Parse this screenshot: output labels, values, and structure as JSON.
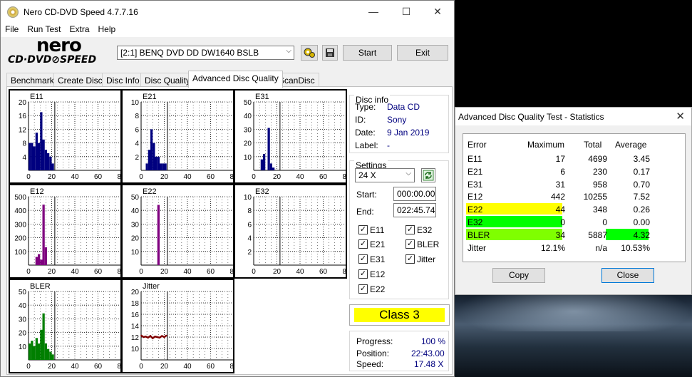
{
  "window": {
    "title": "Nero CD-DVD Speed 4.7.7.16",
    "menu": [
      "File",
      "Run Test",
      "Extra",
      "Help"
    ],
    "controls": [
      "—",
      "☐",
      "✕"
    ]
  },
  "logo": {
    "top": "nero",
    "bottom": "CD·DVD⊘SPEED"
  },
  "toolbar": {
    "drive": "[2:1]   BENQ DVD DD DW1640 BSLB",
    "start_label": "Start",
    "exit_label": "Exit"
  },
  "tabs": [
    "Benchmark",
    "Create Disc",
    "Disc Info",
    "Disc Quality",
    "Advanced Disc Quality",
    "ScanDisc"
  ],
  "active_tab": "Advanced Disc Quality",
  "disc_info": {
    "caption": "Disc info",
    "type_label": "Type:",
    "type": "Data CD",
    "id_label": "ID:",
    "id": "Sony",
    "date_label": "Date:",
    "date": "9 Jan 2019",
    "label_label": "Label:",
    "label": "-"
  },
  "settings": {
    "caption": "Settings",
    "speed": "24 X",
    "start_label": "Start:",
    "start": "000:00.00",
    "end_label": "End:",
    "end": "022:45.74",
    "checks": [
      {
        "label": "E11",
        "checked": true
      },
      {
        "label": "E32",
        "checked": true
      },
      {
        "label": "E21",
        "checked": true
      },
      {
        "label": "BLER",
        "checked": true
      },
      {
        "label": "E31",
        "checked": true
      },
      {
        "label": "Jitter",
        "checked": true
      },
      {
        "label": "E12",
        "checked": true
      },
      {
        "label": "E22",
        "checked": true
      }
    ]
  },
  "class_label": "Class 3",
  "progress": {
    "progress_label": "Progress:",
    "progress": "100 %",
    "position_label": "Position:",
    "position": "22:43.00",
    "speed_label": "Speed:",
    "speed": "17.48 X"
  },
  "colors": {
    "yellow": "#ffff00",
    "green": "#00ff00",
    "bler_green": "#7fff00",
    "plot_blue": "#00007f",
    "plot_purple": "#7f007f",
    "plot_green": "#007f00",
    "plot_maroon": "#7f0000"
  },
  "chart_data": [
    {
      "type": "bar",
      "title": "E11",
      "xlim": [
        0,
        80
      ],
      "ylim": [
        0,
        20
      ],
      "xticks": [
        0,
        20,
        40,
        60,
        80
      ],
      "yticks": [
        4,
        8,
        12,
        16,
        20
      ],
      "color": "#00007f",
      "x": [
        2,
        4,
        6,
        8,
        10,
        12,
        14,
        16,
        18,
        20,
        22
      ],
      "values": [
        8,
        8,
        7,
        11,
        8,
        17,
        9,
        6,
        5,
        4,
        2
      ]
    },
    {
      "type": "bar",
      "title": "E21",
      "xlim": [
        0,
        80
      ],
      "ylim": [
        0,
        10
      ],
      "xticks": [
        0,
        20,
        40,
        60,
        80
      ],
      "yticks": [
        2,
        4,
        6,
        8,
        10
      ],
      "color": "#00007f",
      "x": [
        2,
        4,
        6,
        8,
        10,
        12,
        14,
        16,
        18,
        20,
        22
      ],
      "values": [
        0,
        0,
        1,
        3,
        6,
        4,
        2,
        2,
        1,
        1,
        1
      ]
    },
    {
      "type": "bar",
      "title": "E31",
      "xlim": [
        0,
        80
      ],
      "ylim": [
        0,
        50
      ],
      "xticks": [
        0,
        20,
        40,
        60,
        80
      ],
      "yticks": [
        10,
        20,
        30,
        40,
        50
      ],
      "color": "#00007f",
      "x": [
        8,
        10,
        12,
        14,
        16,
        18
      ],
      "values": [
        8,
        12,
        0,
        31,
        5,
        2
      ]
    },
    {
      "type": "bar",
      "title": "E12",
      "xlim": [
        0,
        80
      ],
      "ylim": [
        0,
        500
      ],
      "xticks": [
        0,
        20,
        40,
        60,
        80
      ],
      "yticks": [
        100,
        200,
        300,
        400,
        500
      ],
      "color": "#7f007f",
      "x": [
        8,
        10,
        12,
        14,
        16
      ],
      "values": [
        60,
        80,
        40,
        442,
        130
      ]
    },
    {
      "type": "bar",
      "title": "E22",
      "xlim": [
        0,
        80
      ],
      "ylim": [
        0,
        50
      ],
      "xticks": [
        0,
        20,
        40,
        60,
        80
      ],
      "yticks": [
        10,
        20,
        30,
        40,
        50
      ],
      "color": "#7f007f",
      "x": [
        14,
        16
      ],
      "values": [
        0,
        44
      ]
    },
    {
      "type": "bar",
      "title": "E32",
      "xlim": [
        0,
        80
      ],
      "ylim": [
        0,
        10
      ],
      "xticks": [
        0,
        20,
        40,
        60,
        80
      ],
      "yticks": [
        2,
        4,
        6,
        8,
        10
      ],
      "color": "#7f007f",
      "x": [],
      "values": []
    },
    {
      "type": "bar",
      "title": "BLER",
      "xlim": [
        0,
        80
      ],
      "ylim": [
        0,
        50
      ],
      "xticks": [
        0,
        20,
        40,
        60,
        80
      ],
      "yticks": [
        10,
        20,
        30,
        40,
        50
      ],
      "color": "#007f00",
      "x": [
        2,
        4,
        6,
        8,
        10,
        12,
        14,
        16,
        18,
        20,
        22
      ],
      "values": [
        12,
        14,
        10,
        16,
        12,
        22,
        34,
        12,
        8,
        6,
        4
      ]
    },
    {
      "type": "line",
      "title": "Jitter",
      "xlim": [
        0,
        80
      ],
      "ylim": [
        8,
        20
      ],
      "xticks": [
        0,
        20,
        40,
        60,
        80
      ],
      "yticks": [
        10,
        12,
        14,
        16,
        18,
        20
      ],
      "color": "#7f0000",
      "x": [
        0,
        2,
        4,
        6,
        8,
        10,
        12,
        14,
        16,
        18,
        20,
        22
      ],
      "values": [
        12.3,
        12.0,
        12.1,
        11.9,
        12.2,
        11.8,
        12.1,
        12.0,
        11.9,
        12.2,
        12.0,
        12.3
      ]
    }
  ],
  "stats": {
    "title": "Advanced Disc Quality Test - Statistics",
    "headers": [
      "Error",
      "Maximum",
      "Total",
      "Average"
    ],
    "rows": [
      {
        "name": "E11",
        "max": "17",
        "total": "4699",
        "avg": "3.45",
        "hl": ""
      },
      {
        "name": "E21",
        "max": "6",
        "total": "230",
        "avg": "0.17",
        "hl": ""
      },
      {
        "name": "E31",
        "max": "31",
        "total": "958",
        "avg": "0.70",
        "hl": ""
      },
      {
        "name": "E12",
        "max": "442",
        "total": "10255",
        "avg": "7.52",
        "hl": ""
      },
      {
        "name": "E22",
        "max": "44",
        "total": "348",
        "avg": "0.26",
        "hl": "yellow"
      },
      {
        "name": "E32",
        "max": "0",
        "total": "0",
        "avg": "0.00",
        "hl": "green"
      },
      {
        "name": "BLER",
        "max": "34",
        "total": "5887",
        "avg": "4.32",
        "hl": "bler"
      },
      {
        "name": "Jitter",
        "max": "12.1%",
        "total": "n/a",
        "avg": "10.53%",
        "hl": ""
      }
    ],
    "copy_label": "Copy",
    "close_label": "Close"
  }
}
